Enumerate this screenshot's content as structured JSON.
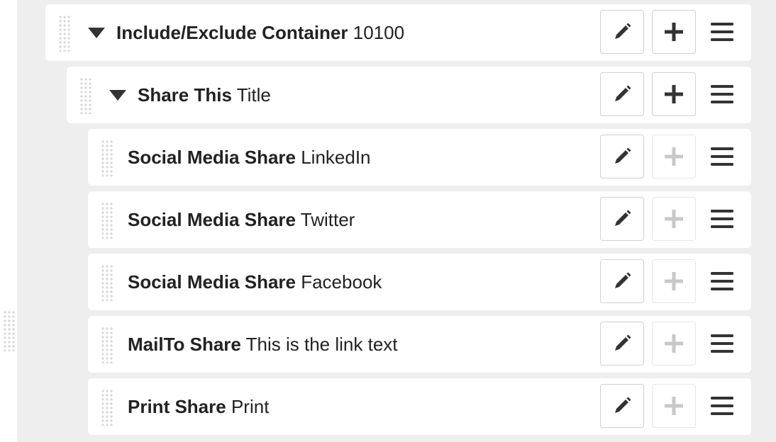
{
  "rows": [
    {
      "type": "Include/Exclude Container",
      "name": "10100",
      "expanded": true,
      "can_add": true
    },
    {
      "type": "Share This",
      "name": "Title",
      "expanded": true,
      "can_add": true
    },
    {
      "type": "Social Media Share",
      "name": "LinkedIn",
      "can_add": false
    },
    {
      "type": "Social Media Share",
      "name": "Twitter",
      "can_add": false
    },
    {
      "type": "Social Media Share",
      "name": "Facebook",
      "can_add": false
    },
    {
      "type": "MailTo Share",
      "name": "This is the link text",
      "can_add": false
    },
    {
      "type": "Print Share",
      "name": "Print",
      "can_add": false
    }
  ],
  "icons": {
    "drag": "drag-handle-icon",
    "expand": "caret-down-icon",
    "edit": "pencil-icon",
    "add": "plus-icon",
    "menu": "hamburger-menu-icon"
  },
  "colors": {
    "panel_bg": "#eeeeee",
    "row_bg": "#ffffff",
    "icon_dark": "#333333",
    "icon_disabled": "#c8c8c8"
  }
}
